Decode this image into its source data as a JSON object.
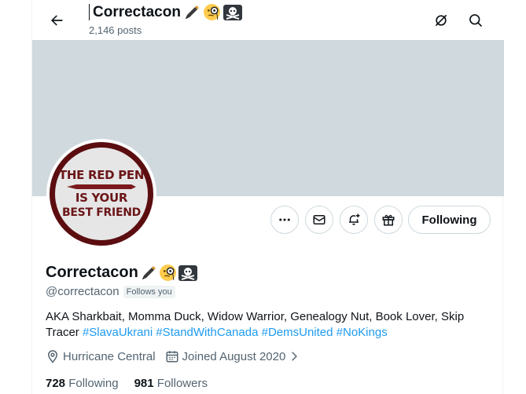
{
  "header": {
    "name": "Correctacon",
    "posts": "2,146 posts"
  },
  "avatar": {
    "line1": "THE RED PEN",
    "line2": "IS YOUR",
    "line3": "BEST FRIEND"
  },
  "actions": {
    "following_label": "Following"
  },
  "profile": {
    "name": "Correctacon",
    "handle": "@correctacon",
    "follows_you": "Follows you",
    "bio_text": "AKA Sharkbait, Momma Duck, Widow Warrior, Genealogy Nut, Book Lover, Skip Tracer",
    "hashtags": [
      "#SlavaUkrani",
      "#StandWithCanada",
      "#DemsUnited",
      "#NoKings"
    ],
    "location": "Hurricane Central",
    "joined": "Joined August 2020",
    "following_count": "728",
    "following_label": "Following",
    "followers_count": "981",
    "followers_label": "Followers"
  },
  "icons": {
    "name_emojis": [
      "pen-icon",
      "monocle-face-icon",
      "skull-crossbones-icon"
    ]
  },
  "colors": {
    "accent": "#1d9bf0",
    "banner": "#cfd9de",
    "secondary_text": "#536471"
  }
}
